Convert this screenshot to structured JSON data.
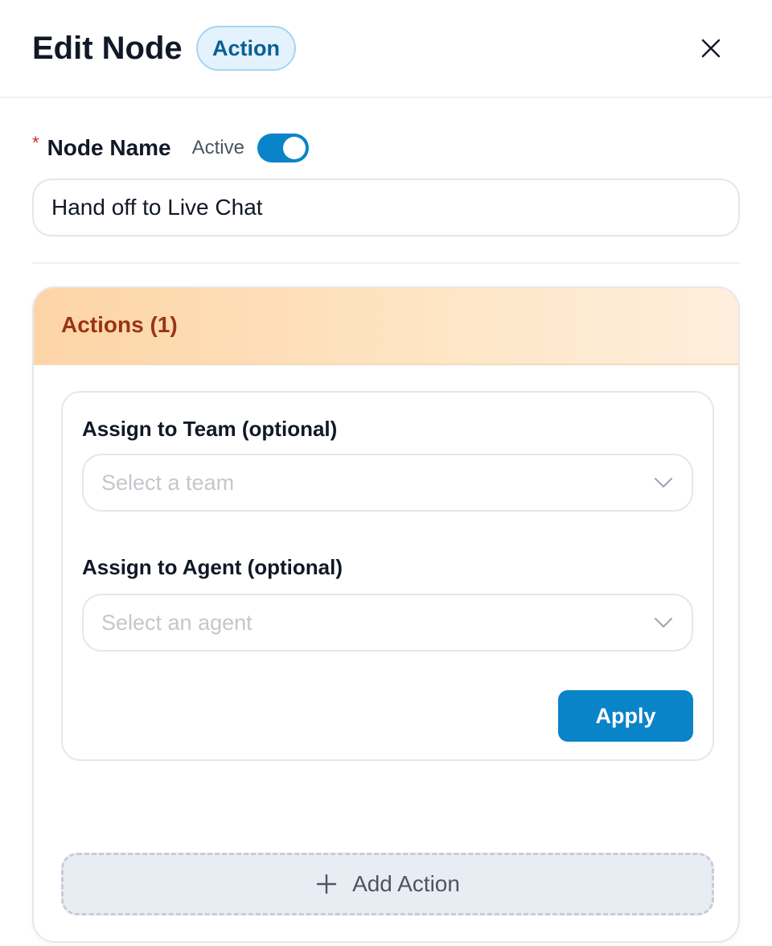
{
  "header": {
    "title": "Edit Node",
    "badge": "Action",
    "close_icon": "close-icon"
  },
  "node": {
    "required_mark": "*",
    "name_label": "Node Name",
    "active_label": "Active",
    "active": true,
    "name_value": "Hand off to Live Chat"
  },
  "actions": {
    "title": "Actions (1)",
    "items": [
      {
        "team_label": "Assign to Team (optional)",
        "team_placeholder": "Select a team",
        "agent_label": "Assign to Agent (optional)",
        "agent_placeholder": "Select an agent",
        "apply_label": "Apply"
      }
    ],
    "add_label": "Add Action"
  },
  "colors": {
    "accent": "#0a84c9",
    "badge_bg": "#e3f2fc",
    "badge_text": "#0a5f93",
    "actions_header_text": "#9a3412",
    "required": "#dc2626"
  }
}
